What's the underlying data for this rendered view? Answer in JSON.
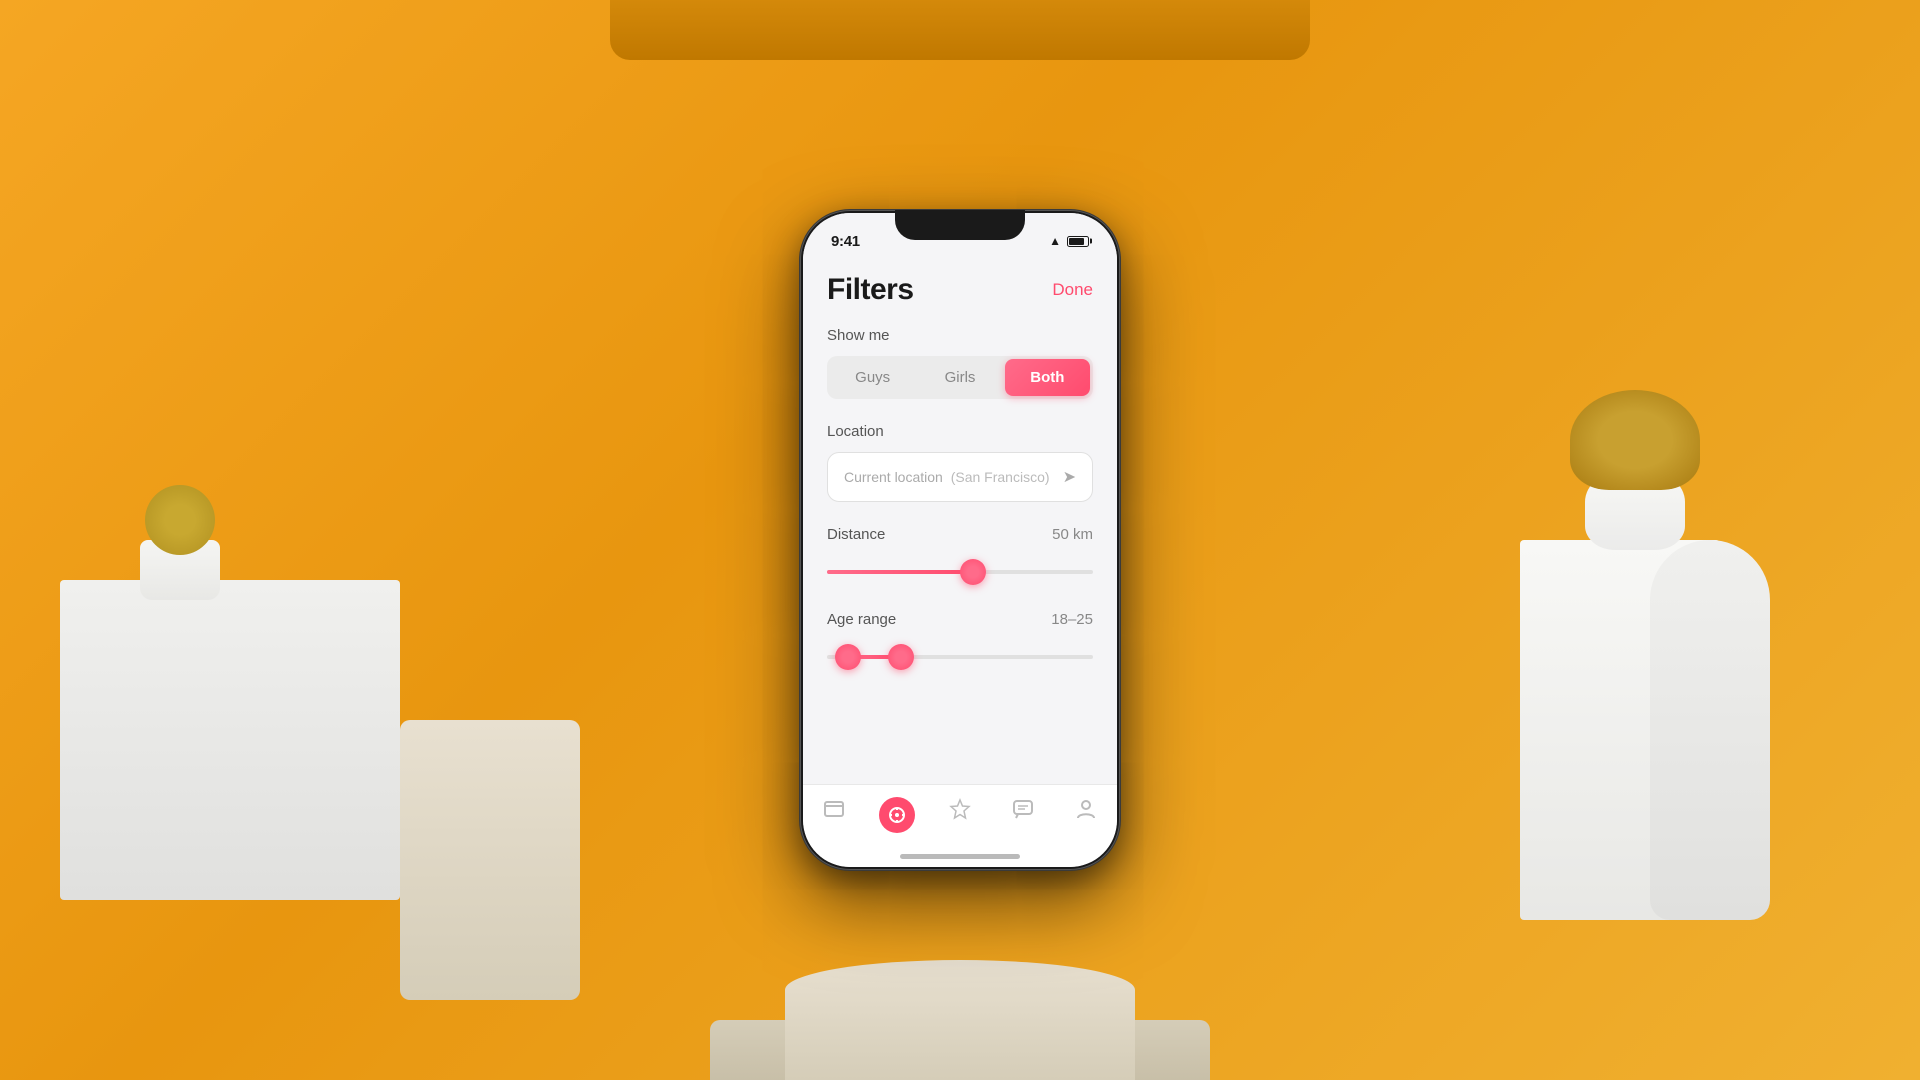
{
  "scene": {
    "background_color": "#F5A623"
  },
  "status_bar": {
    "time": "9:41"
  },
  "header": {
    "title": "Filters",
    "done_button": "Done"
  },
  "show_me": {
    "label": "Show me",
    "options": [
      "Guys",
      "Girls",
      "Both"
    ],
    "selected": "Both"
  },
  "location": {
    "label": "Location",
    "current_location": "Current location",
    "location_detail": "(San Francisco)"
  },
  "distance": {
    "label": "Distance",
    "value": "50 km",
    "percent": 55
  },
  "age_range": {
    "label": "Age range",
    "value": "18–25",
    "min_percent": 8,
    "max_percent": 28
  },
  "bottom_nav": {
    "items": [
      {
        "icon": "📋",
        "name": "cards",
        "active": false
      },
      {
        "icon": "🧭",
        "name": "explore",
        "active": true
      },
      {
        "icon": "⭐",
        "name": "favorites",
        "active": false
      },
      {
        "icon": "💬",
        "name": "messages",
        "active": false
      },
      {
        "icon": "👤",
        "name": "profile",
        "active": false
      }
    ]
  }
}
